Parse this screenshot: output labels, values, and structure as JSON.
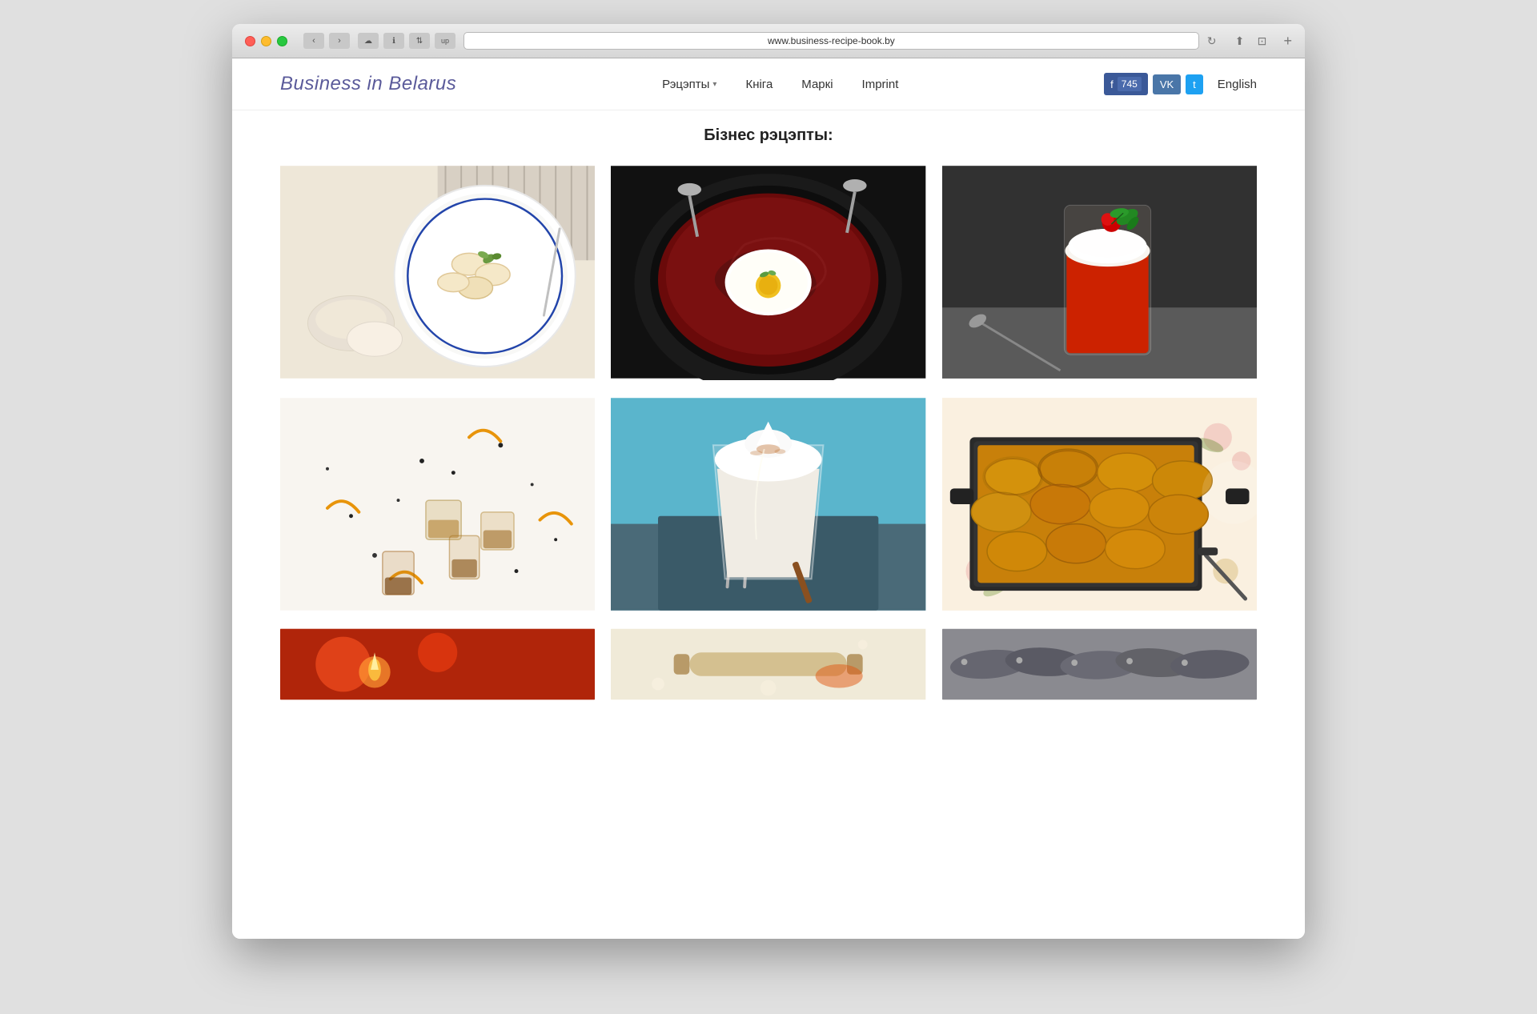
{
  "browser": {
    "url": "www.business-recipe-book.by",
    "back_disabled": false,
    "forward_disabled": false
  },
  "site": {
    "logo": "Business in Belarus",
    "nav": [
      {
        "label": "Рэцэпты",
        "has_dropdown": true
      },
      {
        "label": "Кніга",
        "has_dropdown": false
      },
      {
        "label": "Маркі",
        "has_dropdown": false
      },
      {
        "label": "Imprint",
        "has_dropdown": false
      }
    ],
    "social": {
      "facebook_label": "f",
      "facebook_count": "745",
      "vk_label": "VK",
      "twitter_label": "t"
    },
    "language": "English"
  },
  "main": {
    "page_title": "Бізнес рэцэпты:",
    "recipes": [
      {
        "id": 1,
        "alt": "Dumplings on plate"
      },
      {
        "id": 2,
        "alt": "Beet soup with poached egg"
      },
      {
        "id": 3,
        "alt": "Red cocktail with cream"
      },
      {
        "id": 4,
        "alt": "Spices and oils"
      },
      {
        "id": 5,
        "alt": "Cream dessert in glass"
      },
      {
        "id": 6,
        "alt": "Potato gratin in pan"
      },
      {
        "id": 7,
        "alt": "Partial recipe 1"
      },
      {
        "id": 8,
        "alt": "Partial recipe 2"
      },
      {
        "id": 9,
        "alt": "Partial recipe 3"
      }
    ]
  }
}
